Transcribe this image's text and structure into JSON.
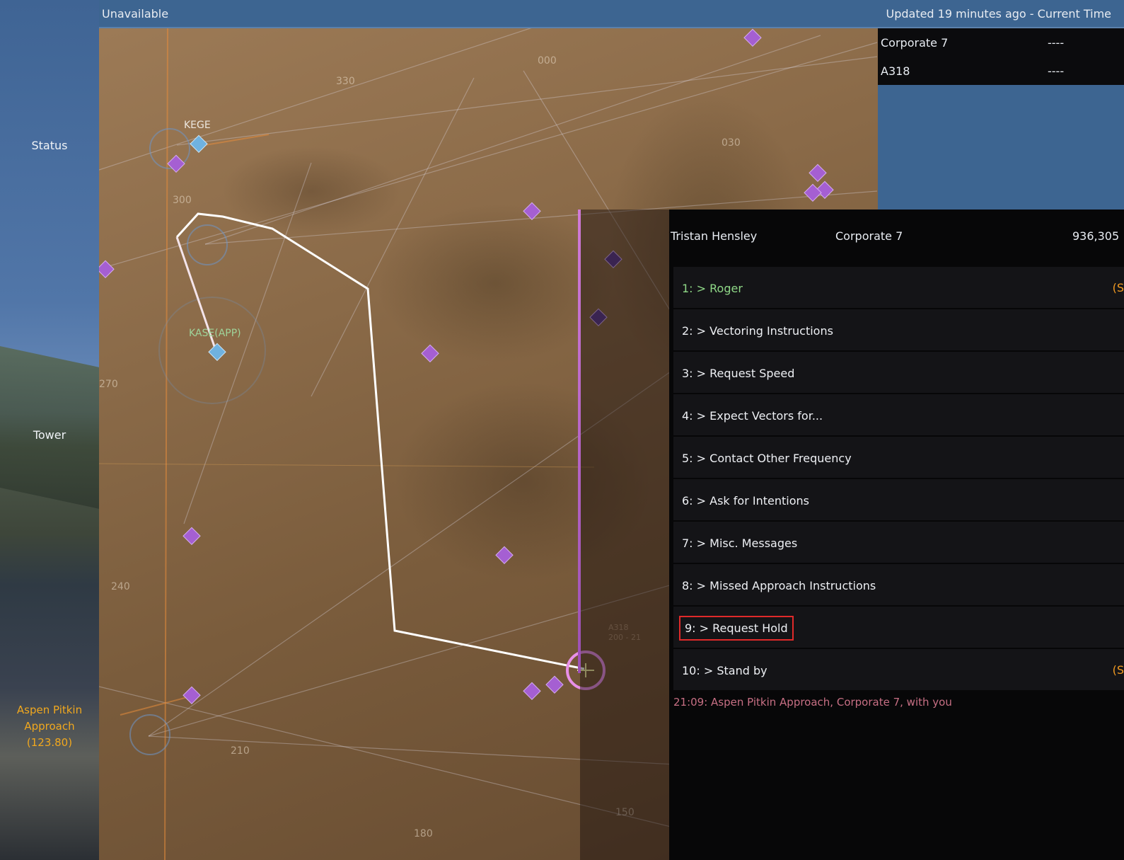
{
  "topbar": {
    "left": "Unavailable",
    "right": "Updated 19 minutes ago - Current Time"
  },
  "sidebar": {
    "status": "Status",
    "tower": "Tower",
    "approach_freq": [
      "Aspen Pitkin",
      "Approach",
      "(123.80)"
    ]
  },
  "map": {
    "airports": [
      {
        "label": "KEGE",
        "style": "normal"
      },
      {
        "label": "KASE(APP)",
        "style": "green"
      }
    ],
    "bearings": [
      "000",
      "030",
      "330",
      "300",
      "270",
      "240",
      "210",
      "180",
      "150"
    ],
    "aircraft_tag": [
      "A318",
      "200 - 21"
    ]
  },
  "traffic": [
    {
      "callsign": "Corporate 7",
      "status": "----"
    },
    {
      "callsign": "A318",
      "status": "----"
    }
  ],
  "comms": {
    "controller": "Tristan Hensley",
    "aircraft": "Corporate 7",
    "score": "936,305",
    "items": [
      {
        "label": "1: > Roger",
        "right": "(S"
      },
      {
        "label": "2: > Vectoring Instructions",
        "right": ""
      },
      {
        "label": "3: > Request Speed",
        "right": ""
      },
      {
        "label": "4: > Expect Vectors for...",
        "right": ""
      },
      {
        "label": "5: > Contact Other Frequency",
        "right": ""
      },
      {
        "label": "6: > Ask for Intentions",
        "right": ""
      },
      {
        "label": "7: > Misc. Messages",
        "right": ""
      },
      {
        "label": "8: > Missed Approach Instructions",
        "right": ""
      },
      {
        "label": "9: > Request Hold",
        "right": ""
      },
      {
        "label": "10: > Stand by",
        "right": "(S"
      }
    ],
    "log": "21:09: Aspen Pitkin Approach, Corporate 7, with you"
  },
  "colors": {
    "accent_orange": "#f1a81e",
    "selected_green": "#8fd887",
    "highlight_red": "#e02a2a",
    "route_white": "#ffffff",
    "target_pink": "#e890e8"
  }
}
